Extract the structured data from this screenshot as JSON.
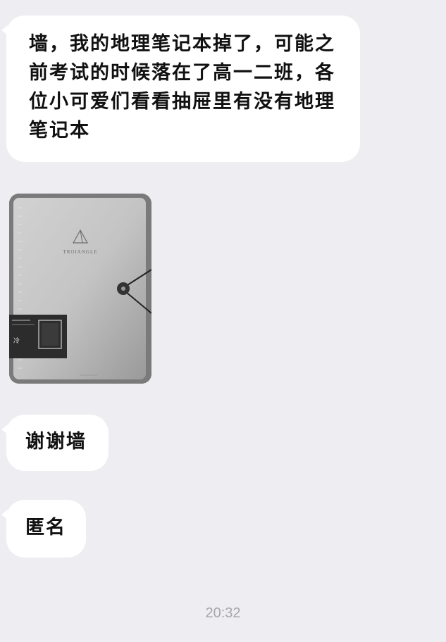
{
  "chat": {
    "messages": [
      {
        "type": "text",
        "sender": "other",
        "text": "墙，我的地理笔记本掉了，可能之前考试的时候落在了高一二班，各位小可爱们看看抽屉里有没有地理笔记本"
      },
      {
        "type": "image",
        "sender": "other",
        "image_desc": "notebook-folder-photo",
        "brand_text": "TROIANGLE"
      },
      {
        "type": "text",
        "sender": "other",
        "text": "谢谢墙"
      },
      {
        "type": "text",
        "sender": "other",
        "text": "匿名"
      }
    ],
    "timestamp": "20:32"
  },
  "theme": {
    "background": "#ededf2",
    "bubble": "#ffffff",
    "text": "#111111",
    "timestamp_color": "#a6a6ab"
  }
}
